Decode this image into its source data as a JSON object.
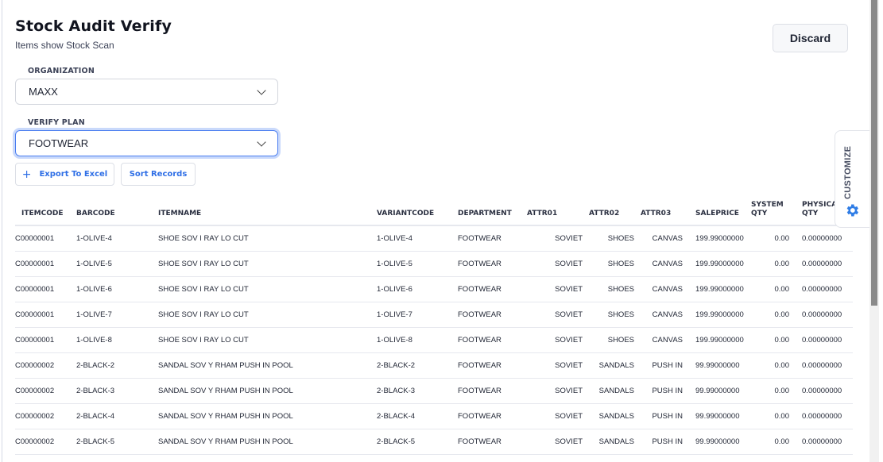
{
  "header": {
    "title": "Stock Audit Verify",
    "subtitle": "Items show Stock Scan",
    "discard_label": "Discard"
  },
  "filters": {
    "organization": {
      "label": "ORGANIZATION",
      "value": "MAXX"
    },
    "verify_plan": {
      "label": "VERIFY PLAN",
      "value": "FOOTWEAR"
    }
  },
  "actions": {
    "export_label": "Export To Excel",
    "sort_label": "Sort Records"
  },
  "customize_label": "CUSTOMIZE",
  "table": {
    "columns": [
      "ITEMCODE",
      "BARCODE",
      "ITEMNAME",
      "VARIANTCODE",
      "DEPARTMENT",
      "ATTR01",
      "ATTR02",
      "ATTR03",
      "SALEPRICE",
      "SYSTEM QTY",
      "PHYSICAL QTY"
    ],
    "rows": [
      [
        "C00000001",
        "1-OLIVE-4",
        "SHOE SOV I RAY LO CUT",
        "1-OLIVE-4",
        "FOOTWEAR",
        "SOVIET",
        "SHOES",
        "CANVAS",
        "199.99000000",
        "0.00",
        "0.00000000"
      ],
      [
        "C00000001",
        "1-OLIVE-5",
        "SHOE SOV I RAY LO CUT",
        "1-OLIVE-5",
        "FOOTWEAR",
        "SOVIET",
        "SHOES",
        "CANVAS",
        "199.99000000",
        "0.00",
        "0.00000000"
      ],
      [
        "C00000001",
        "1-OLIVE-6",
        "SHOE SOV I RAY LO CUT",
        "1-OLIVE-6",
        "FOOTWEAR",
        "SOVIET",
        "SHOES",
        "CANVAS",
        "199.99000000",
        "0.00",
        "0.00000000"
      ],
      [
        "C00000001",
        "1-OLIVE-7",
        "SHOE SOV I RAY LO CUT",
        "1-OLIVE-7",
        "FOOTWEAR",
        "SOVIET",
        "SHOES",
        "CANVAS",
        "199.99000000",
        "0.00",
        "0.00000000"
      ],
      [
        "C00000001",
        "1-OLIVE-8",
        "SHOE SOV I RAY LO CUT",
        "1-OLIVE-8",
        "FOOTWEAR",
        "SOVIET",
        "SHOES",
        "CANVAS",
        "199.99000000",
        "0.00",
        "0.00000000"
      ],
      [
        "C00000002",
        "2-BLACK-2",
        "SANDAL SOV Y RHAM PUSH IN POOL",
        "2-BLACK-2",
        "FOOTWEAR",
        "SOVIET",
        "SANDALS",
        "PUSH IN",
        "99.99000000",
        "0.00",
        "0.00000000"
      ],
      [
        "C00000002",
        "2-BLACK-3",
        "SANDAL SOV Y RHAM PUSH IN POOL",
        "2-BLACK-3",
        "FOOTWEAR",
        "SOVIET",
        "SANDALS",
        "PUSH IN",
        "99.99000000",
        "0.00",
        "0.00000000"
      ],
      [
        "C00000002",
        "2-BLACK-4",
        "SANDAL SOV Y RHAM PUSH IN POOL",
        "2-BLACK-4",
        "FOOTWEAR",
        "SOVIET",
        "SANDALS",
        "PUSH IN",
        "99.99000000",
        "0.00",
        "0.00000000"
      ],
      [
        "C00000002",
        "2-BLACK-5",
        "SANDAL SOV Y RHAM PUSH IN POOL",
        "2-BLACK-5",
        "FOOTWEAR",
        "SOVIET",
        "SANDALS",
        "PUSH IN",
        "99.99000000",
        "0.00",
        "0.00000000"
      ]
    ]
  }
}
